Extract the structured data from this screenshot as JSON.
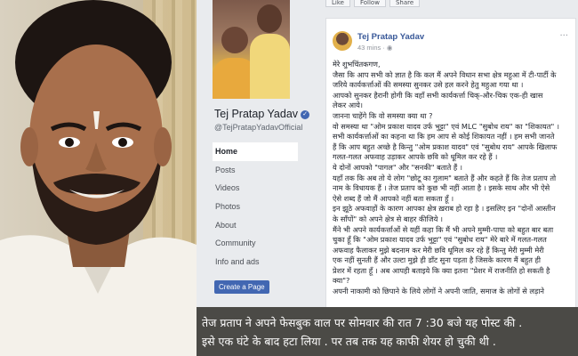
{
  "facebook": {
    "top_buttons": [
      "Like",
      "Follow",
      "Share"
    ],
    "page_name": "Tej Pratap Yadav",
    "handle": "@TejPratapYadavOfficial",
    "nav": [
      "Home",
      "Posts",
      "Videos",
      "Photos",
      "About",
      "Community",
      "Info and ads"
    ],
    "create_page_label": "Create a Page",
    "post": {
      "author": "Tej Pratap Yadav",
      "time": "43 mins · ◉",
      "lines": [
        "मेरे शुभचिंतकगण,",
        "जैसा कि आप सभी को ज्ञात है कि कल मैं अपने विधान सभा क्षेत्र महुआ में टी-पार्टी के",
        "जरिये कार्यकर्त्ताओं की समस्या सुनकर उसे हल करने हेतु महुआ गया था ।",
        "आपको सुनकर हैरानी होगी कि वहाँ सभी कार्यकर्त्ता चिक्-और-चिक एक-ही खास",
        "लेकर आये।",
        "जानना चाहेंगे कि वो समस्या क्या था ?",
        "वो समस्या था \"ओम प्रकाश यादव उर्फ भुट्टा\" एवं MLC \"सुबोध राय\" का \"शिकायत\" ।",
        "सभी कार्यकर्त्ताओं का कहना था कि हम आप से कोई शिकायत नहीं । हम सभी जानते",
        "हैं कि आप बहुत अच्छे है किन्तु \"ओम प्रकाश यादव\" एवं \"सुबोध राय\" आपके खिलाफ",
        "गलत-गलत अफवाह उड़ाकर आपके छवि को धूमिल कर रहे हैं ।",
        "ये दोनों आपको \"पागल\" और \"सनकी\" बताते हैं ।",
        "यहाँ तक कि अब तो ये लोग \"छोटू का गुलाम\" बताते हैं और कहते हैं कि तेज प्रताप तो",
        "नाम के विधायक हैं । तेज प्रताप को कुछ भी नहीं आता है । इसके साथ और भी ऐसे",
        "ऐसे शब्द हैं जो मैं आपको नहीं बता सकता हूँ ।",
        "इन झूठे अफवाहों के कारण आपका क्षेत्र ख़राब हो रहा है । इसलिए इन \"दोनों आस्तीन",
        "के साँपों\" को अपने क्षेत्र से बाहर कीजिये ।",
        "मैंने भी अपने कार्यकर्त्ताओं से यहीं कहा कि मैं भी अपने मुम्मी-पापा को बहुत बार बता",
        "चुका हूँ कि \"ओम प्रकाश यादव उर्फ भुट्टा\" एवं \"सुबोध राय\" मेरे बारे में गलत-गलत",
        "अफवाह फैलाकर मुझे बदनाम कर मेरी छवि धूमिल कर रहे हैं किन्तु मेरी मुम्मी मेरी",
        "एक नहीं सुनती हैं और उल्टा मुझे ही डाँट सुना पड़ता है जिसके कारण मैं बहुत ही",
        "प्रेशर में रहता हूँ । अब आपही बताइये कि क्या इतना \"प्रेशर में राजनीति हो सकती है",
        "क्या\"?",
        "अपनी नाकामी को छिपाने के लिये लोगों ने अपनी जाति, समाज के लोगों से लड़ाने"
      ]
    }
  },
  "caption": {
    "line1": "तेज प्रताप ने अपने फेसबुक वाल पर सोमवार की रात 7 :30 बजे यह पोस्ट की .",
    "line2": "इसे एक घंटे के बाद हटा लिया . पर तब तक यह काफी शेयर हो चुकी थी ."
  }
}
